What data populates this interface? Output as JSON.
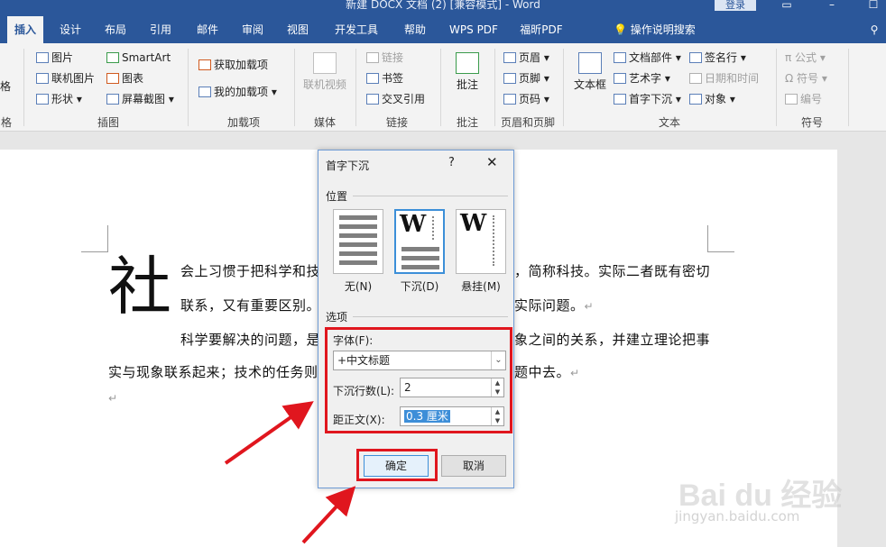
{
  "window": {
    "title": "新建 DOCX 文档 (2) [兼容模式] - Word",
    "login": "登录"
  },
  "tabs": [
    "插入",
    "设计",
    "布局",
    "引用",
    "邮件",
    "审阅",
    "视图",
    "开发工具",
    "帮助",
    "WPS PDF",
    "福昕PDF"
  ],
  "tell_me": "操作说明搜索",
  "ribbon": {
    "table_frag": "格",
    "table_label_frag": "格",
    "illus": {
      "pictures": "图片",
      "online_pictures": "联机图片",
      "shapes": "形状",
      "smartart": "SmartArt",
      "chart": "图表",
      "screenshot": "屏幕截图",
      "label": "插图"
    },
    "addins": {
      "get": "获取加载项",
      "mine": "我的加载项",
      "label": "加载项"
    },
    "media": {
      "online_video": "联机视频",
      "label": "媒体"
    },
    "links": {
      "link": "链接",
      "bookmark": "书签",
      "crossref": "交叉引用",
      "label": "链接"
    },
    "comments": {
      "comment": "批注",
      "label": "批注"
    },
    "header_footer": {
      "header": "页眉",
      "footer": "页脚",
      "page_number": "页码",
      "label": "页眉和页脚"
    },
    "text": {
      "textbox": "文本框",
      "quick_parts": "文档部件",
      "wordart": "艺术字",
      "dropcap": "首字下沉",
      "signature": "签名行",
      "datetime": "日期和时间",
      "object": "对象",
      "label": "文本"
    },
    "symbols": {
      "equation": "公式",
      "symbol": "符号",
      "numbering": "编号",
      "label": "符号"
    }
  },
  "document": {
    "dropcap_char": "社",
    "lines": [
      "会上习惯于把科学和技",
      "，简称科技。实际二者既有密切",
      "联系，又有重要区别。",
      "实际问题。",
      "科学要解决的问题，是",
      "象之间的关系，并建立理论把事",
      "实与现象联系起来；技术的任务则",
      "题中去。"
    ],
    "para_mark": "↵"
  },
  "dialog": {
    "title": "首字下沉",
    "help": "?",
    "close": "✕",
    "position_label": "位置",
    "options": [
      "无(N)",
      "下沉(D)",
      "悬挂(M)"
    ],
    "options_label": "选项",
    "font_label": "字体(F):",
    "font_value": "+中文标题",
    "lines_label": "下沉行数(L):",
    "lines_value": "2",
    "distance_label": "距正文(X):",
    "distance_value": "0.3 厘米",
    "ok": "确定",
    "cancel": "取消"
  },
  "watermark": {
    "brand": "Bai du 经验",
    "url": "jingyan.baidu.com"
  },
  "colors": {
    "accent": "#2b579a",
    "highlight": "#e0161e",
    "selection": "#3d8ed8"
  }
}
